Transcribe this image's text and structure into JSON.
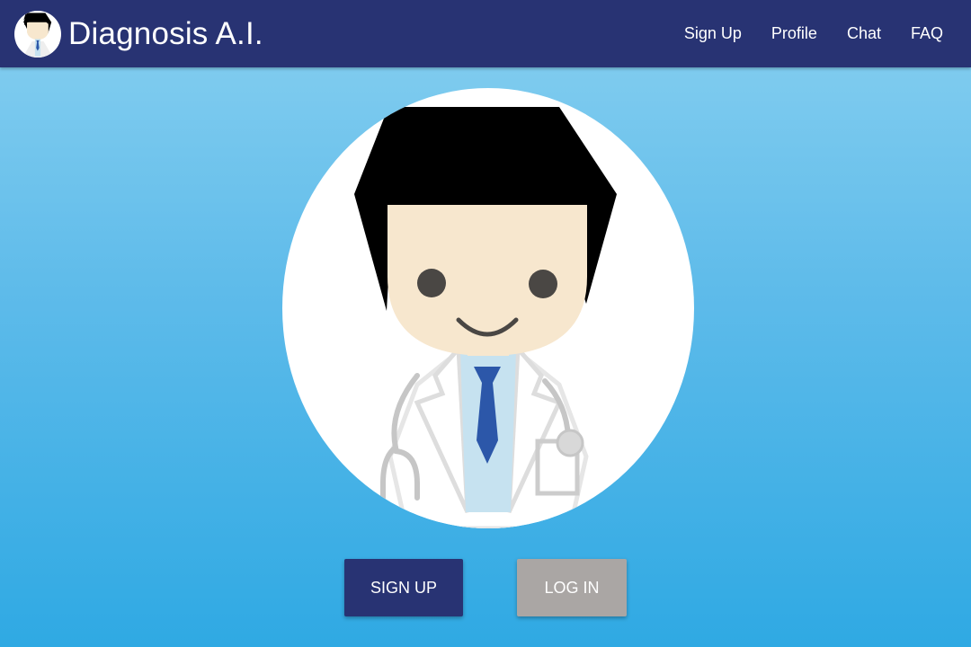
{
  "navbar": {
    "brand": {
      "title": "Diagnosis A.I.",
      "logo_icon": "doctor-avatar-icon"
    },
    "links": [
      "Sign Up",
      "Profile",
      "Chat",
      "FAQ"
    ]
  },
  "hero": {
    "illustration_icon": "doctor-avatar-icon"
  },
  "actions": {
    "signup_label": "Sign Up",
    "login_label": "Log In"
  },
  "colors": {
    "navbar": "#283373",
    "primary_button": "#283373",
    "secondary_button": "#aaa6a4",
    "background_top": "#88d0f0",
    "background_bottom": "#2fa9e3"
  }
}
